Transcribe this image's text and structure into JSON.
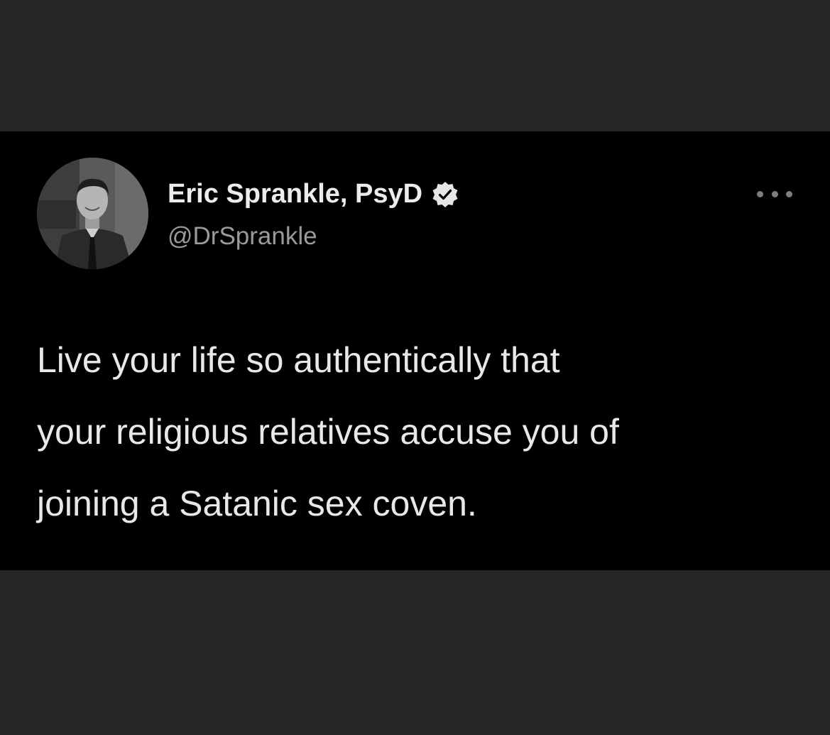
{
  "tweet": {
    "author": {
      "display_name": "Eric Sprankle, PsyD",
      "handle": "@DrSprankle",
      "verified": true,
      "avatar_icon": "profile-photo"
    },
    "body_lines": [
      "Live your life so authentically that",
      "your religious relatives accuse you of",
      "joining a Satanic sex coven."
    ],
    "more_icon": "ellipsis-icon"
  },
  "colors": {
    "outer_background": "#242527",
    "card_background": "#000000",
    "name_color": "#ececec",
    "handle_color": "#9a9a9a",
    "body_color": "#e8e8e8"
  }
}
